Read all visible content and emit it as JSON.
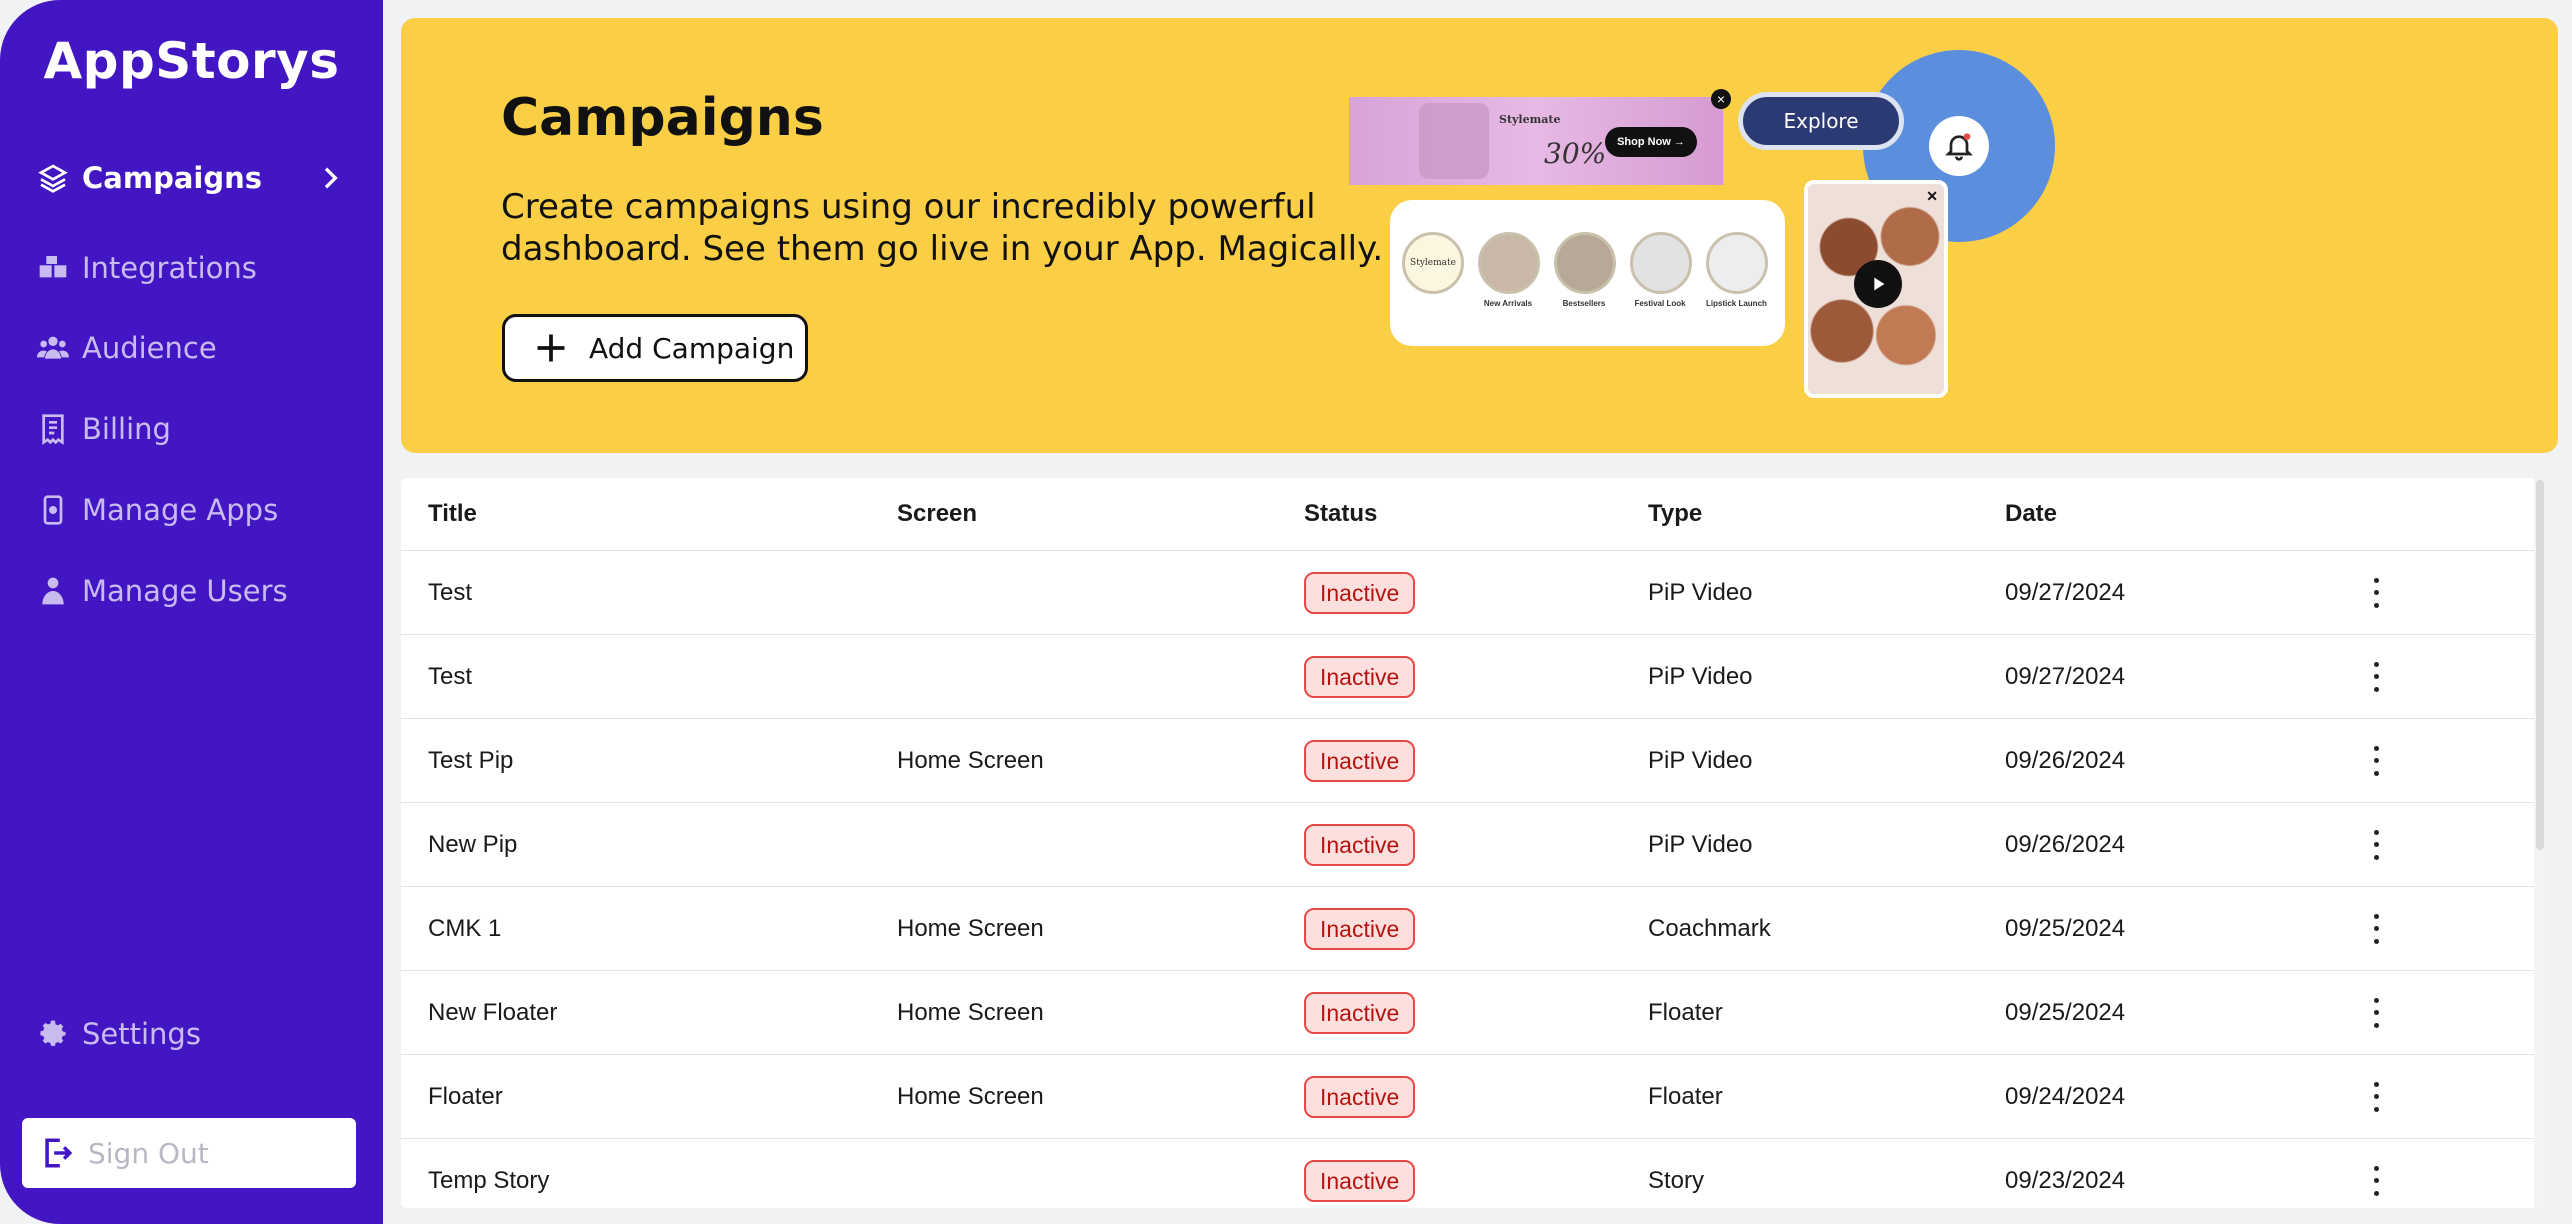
{
  "app": {
    "name": "AppStorys"
  },
  "sidebar": {
    "items": [
      {
        "label": "Campaigns",
        "icon": "layers-icon",
        "active": true
      },
      {
        "label": "Integrations",
        "icon": "puzzle-icon"
      },
      {
        "label": "Audience",
        "icon": "users-icon"
      },
      {
        "label": "Billing",
        "icon": "receipt-icon"
      },
      {
        "label": "Manage Apps",
        "icon": "phone-icon"
      },
      {
        "label": "Manage Users",
        "icon": "user-icon"
      }
    ],
    "settings_label": "Settings",
    "signout_label": "Sign Out"
  },
  "banner": {
    "title": "Campaigns",
    "description": "Create campaigns using our incredibly powerful dashboard. See them go live in your App. Magically.",
    "add_button": "Add Campaign",
    "illustration": {
      "brand": "Stylemate",
      "discount": "30%",
      "shop_now": "Shop Now →",
      "explore": "Explore",
      "stories": [
        "Stylemate",
        "New Arrivals",
        "Bestsellers",
        "Festival Look",
        "Lipstick Launch"
      ]
    }
  },
  "table": {
    "headers": {
      "title": "Title",
      "screen": "Screen",
      "status": "Status",
      "type": "Type",
      "date": "Date"
    },
    "rows": [
      {
        "title": "Test",
        "screen": "",
        "status": "Inactive",
        "type": "PiP Video",
        "date": "09/27/2024"
      },
      {
        "title": "Test",
        "screen": "",
        "status": "Inactive",
        "type": "PiP Video",
        "date": "09/27/2024"
      },
      {
        "title": "Test Pip",
        "screen": "Home Screen",
        "status": "Inactive",
        "type": "PiP Video",
        "date": "09/26/2024"
      },
      {
        "title": "New Pip",
        "screen": "",
        "status": "Inactive",
        "type": "PiP Video",
        "date": "09/26/2024"
      },
      {
        "title": "CMK 1",
        "screen": "Home Screen",
        "status": "Inactive",
        "type": "Coachmark",
        "date": "09/25/2024"
      },
      {
        "title": "New Floater",
        "screen": "Home Screen",
        "status": "Inactive",
        "type": "Floater",
        "date": "09/25/2024"
      },
      {
        "title": "Floater",
        "screen": "Home Screen",
        "status": "Inactive",
        "type": "Floater",
        "date": "09/24/2024"
      },
      {
        "title": "Temp Story",
        "screen": "",
        "status": "Inactive",
        "type": "Story",
        "date": "09/23/2024"
      }
    ]
  },
  "colors": {
    "sidebar": "#4316C4",
    "banner": "#FACF45",
    "inactive_badge_bg": "#FDE0DE",
    "inactive_badge_border": "#E64A47"
  }
}
